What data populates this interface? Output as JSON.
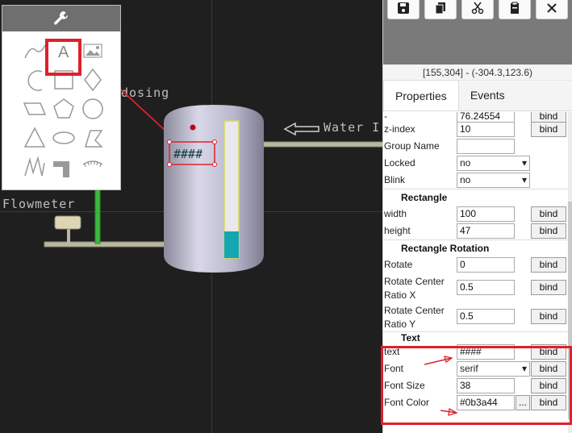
{
  "canvas": {
    "labels": {
      "dosing": "dosing",
      "water": "Water I",
      "flowmeter": "Flowmeter"
    },
    "text_placeholder": "####"
  },
  "palette": {
    "tools": [
      "curve-icon",
      "text-icon",
      "image-icon",
      "arc-icon",
      "rectangle-icon",
      "diamond-icon",
      "parallelogram-icon",
      "pentagon-icon",
      "circle-icon",
      "triangle-icon",
      "ellipse-icon",
      "polyline-icon",
      "zigzag-icon",
      "pipe-icon",
      "gauge-icon"
    ],
    "highlight_color": "#e0202a"
  },
  "toolbar": {
    "buttons": [
      "save-icon",
      "copy-icon",
      "cut-icon",
      "clipboard-icon",
      "close-icon"
    ]
  },
  "coords": "[155,304] - (-304.3,123.6)",
  "tabs": {
    "properties": "Properties",
    "events": "Events"
  },
  "props": {
    "top_value": "76.24554",
    "zindex_label": "z-index",
    "zindex_value": "10",
    "group_label": "Group Name",
    "group_value": "",
    "locked_label": "Locked",
    "locked_value": "no",
    "blink_label": "Blink",
    "blink_value": "no",
    "rect_section": "Rectangle",
    "width_label": "width",
    "width_value": "100",
    "height_label": "height",
    "height_value": "47",
    "rot_section": "Rectangle Rotation",
    "rotate_label": "Rotate",
    "rotate_value": "0",
    "rcx_label1": "Rotate Center",
    "rcx_label2": "Ratio X",
    "rcx_value": "0.5",
    "rcy_label1": "Rotate Center",
    "rcy_label2": "Ratio Y",
    "rcy_value": "0.5",
    "text_section": "Text",
    "text_label": "text",
    "text_value": "####",
    "font_label": "Font",
    "font_value": "serif",
    "fsize_label": "Font Size",
    "fsize_value": "38",
    "fcolor_label": "Font Color",
    "fcolor_value": "#0b3a44",
    "fcolor_more": "...",
    "bind": "bind"
  },
  "colors": {
    "accent": "#e0202a",
    "pipe": "#b8b8a0",
    "green_pipe": "#3bb83b",
    "water": "#14a6b3",
    "level_frame": "#d8d85a"
  }
}
